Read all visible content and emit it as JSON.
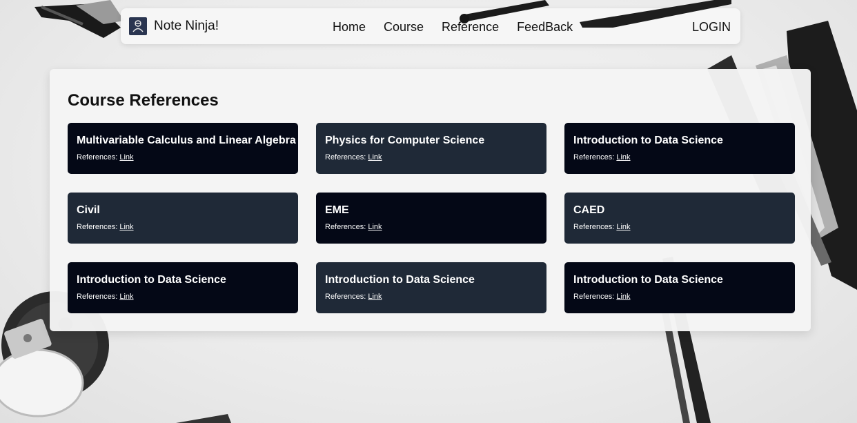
{
  "brand": {
    "name": "Note Ninja!",
    "icon": "ninja-logo-icon"
  },
  "nav": {
    "links": [
      "Home",
      "Course",
      "Reference",
      "FeedBack"
    ],
    "login": "LOGIN"
  },
  "page": {
    "title": "Course References"
  },
  "courses": [
    {
      "title": "Multivariable Calculus and Linear Algebra",
      "ref_label": "References:",
      "link_label": "Link"
    },
    {
      "title": "Physics for Computer Science",
      "ref_label": "References:",
      "link_label": "Link"
    },
    {
      "title": "Introduction to Data Science",
      "ref_label": "References:",
      "link_label": "Link"
    },
    {
      "title": "Civil",
      "ref_label": "References:",
      "link_label": "Link"
    },
    {
      "title": "EME",
      "ref_label": "References:",
      "link_label": "Link"
    },
    {
      "title": "CAED",
      "ref_label": "References:",
      "link_label": "Link"
    },
    {
      "title": "Introduction to Data Science",
      "ref_label": "References:",
      "link_label": "Link"
    },
    {
      "title": "Introduction to Data Science",
      "ref_label": "References:",
      "link_label": "Link"
    },
    {
      "title": "Introduction to Data Science",
      "ref_label": "References:",
      "link_label": "Link"
    }
  ],
  "colors": {
    "card_dark": "#040816",
    "card_slate": "#1f2937",
    "brand_icon_bg": "#2a3550"
  }
}
